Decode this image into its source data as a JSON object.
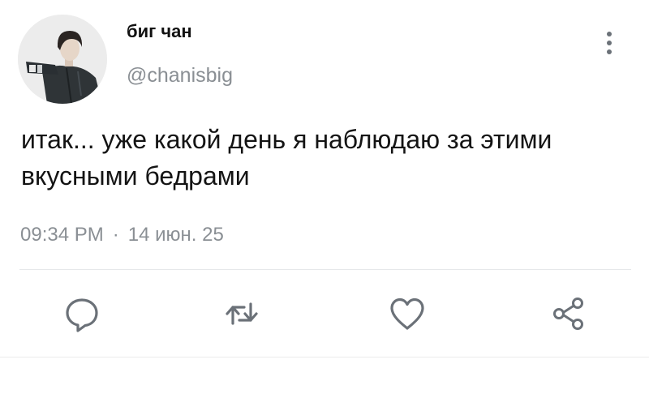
{
  "tweet": {
    "author": {
      "display_name": "биг чан",
      "handle": "@chanisbig"
    },
    "text": "итак... уже какой день я наблюдаю за этими вкусными бедрами",
    "time": "09:34 PM",
    "separator": "·",
    "date": "14 июн. 25"
  },
  "actions": {
    "reply_icon": "reply-icon",
    "retweet_icon": "retweet-icon",
    "like_icon": "heart-icon",
    "share_icon": "share-icon",
    "more_icon": "more-vertical-icon"
  },
  "colors": {
    "text": "#141414",
    "muted": "#8a8f94",
    "icon": "#6b7178",
    "divider": "#e6e8ea"
  }
}
